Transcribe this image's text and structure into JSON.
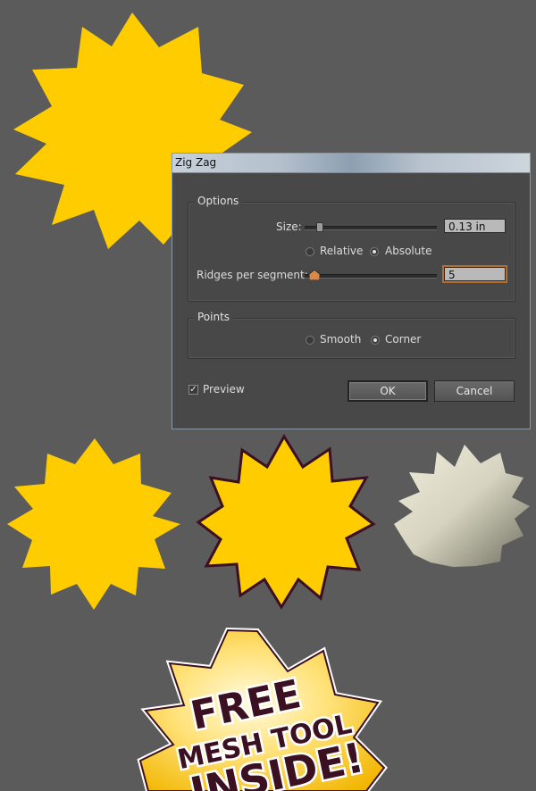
{
  "dialog": {
    "title": "Zig Zag",
    "options_group": {
      "legend": "Options",
      "size_label": "Size:",
      "size_value": "0.13 in",
      "size_slider_fraction": 0.07,
      "mode_relative": "Relative",
      "mode_absolute": "Absolute",
      "selected_mode": "Absolute",
      "ridges_label": "Ridges per segment:",
      "ridges_value": "5",
      "ridges_slider_fraction": 0.05
    },
    "points_group": {
      "legend": "Points",
      "smooth": "Smooth",
      "corner": "Corner",
      "selected": "Corner"
    },
    "preview_label": "Preview",
    "preview_checked": true,
    "ok_label": "OK",
    "cancel_label": "Cancel"
  },
  "badge": {
    "line1": "FREE",
    "line2": "MESH TOOL",
    "line3": "INSIDE!"
  },
  "colors": {
    "background": "#5b5b5b",
    "star_yellow": "#ffcc00",
    "star_outline": "#3b1020",
    "mesh_light": "#e8e6d4",
    "mesh_dark": "#8c8a78",
    "dialog_bg": "#484848",
    "focus_orange": "#b26e33"
  }
}
